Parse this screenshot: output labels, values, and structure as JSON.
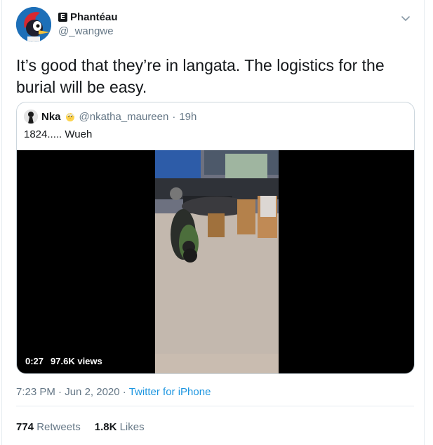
{
  "author": {
    "name": "Phantéau",
    "badge": "E",
    "handle": "@_wangwe"
  },
  "tweet": {
    "text": "It’s good that they’re in langata. The logistics for the burial will be easy."
  },
  "quoted": {
    "name": "Nka",
    "handle": "@nkatha_maureen",
    "time": "19h",
    "text": "1824..... Wueh",
    "video": {
      "duration": "0:27",
      "views": "97.6K views"
    }
  },
  "meta": {
    "time": "7:23 PM",
    "date": "Jun 2, 2020",
    "source": "Twitter for iPhone"
  },
  "stats": {
    "retweets_count": "774",
    "retweets_label": "Retweets",
    "likes_count": "1.8K",
    "likes_label": "Likes"
  },
  "colors": {
    "link": "#1b95e0",
    "secondary_text": "#657786",
    "border": "#ccd6dd"
  },
  "icons": {
    "chevron": "chevron-down-icon",
    "avatar": "woodpecker-avatar",
    "quote_avatar": "quote-user-avatar",
    "emoji": "chick-emoji"
  }
}
